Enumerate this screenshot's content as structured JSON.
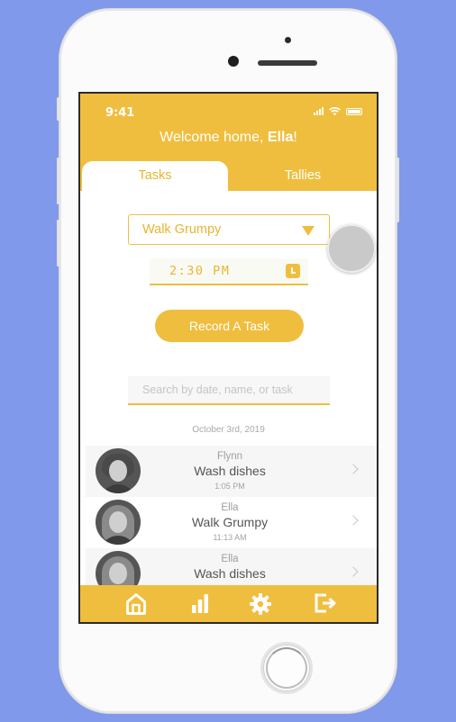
{
  "status_bar": {
    "time": "9:41"
  },
  "header": {
    "welcome_prefix": "Welcome home, ",
    "welcome_name": "Ella",
    "welcome_suffix": "!"
  },
  "tabs": [
    {
      "label": "Tasks",
      "active": true
    },
    {
      "label": "Tallies",
      "active": false
    }
  ],
  "task_select": {
    "value": "Walk Grumpy"
  },
  "time_input": {
    "value": "2:30 PM"
  },
  "record_button": {
    "label": "Record A Task"
  },
  "search": {
    "placeholder": "Search by date, name, or task"
  },
  "log": {
    "date_heading": "October 3rd, 2019",
    "entries": [
      {
        "name": "Flynn",
        "task": "Wash dishes",
        "time": "1:05 PM"
      },
      {
        "name": "Ella",
        "task": "Walk Grumpy",
        "time": "11:13 AM"
      },
      {
        "name": "Ella",
        "task": "Wash dishes",
        "time": ""
      }
    ]
  },
  "bottom_nav": {
    "items": [
      {
        "icon": "home-icon"
      },
      {
        "icon": "bar-chart-icon"
      },
      {
        "icon": "gear-icon"
      },
      {
        "icon": "logout-icon"
      }
    ]
  },
  "colors": {
    "accent": "#f0be3e",
    "background": "#8199ea"
  }
}
